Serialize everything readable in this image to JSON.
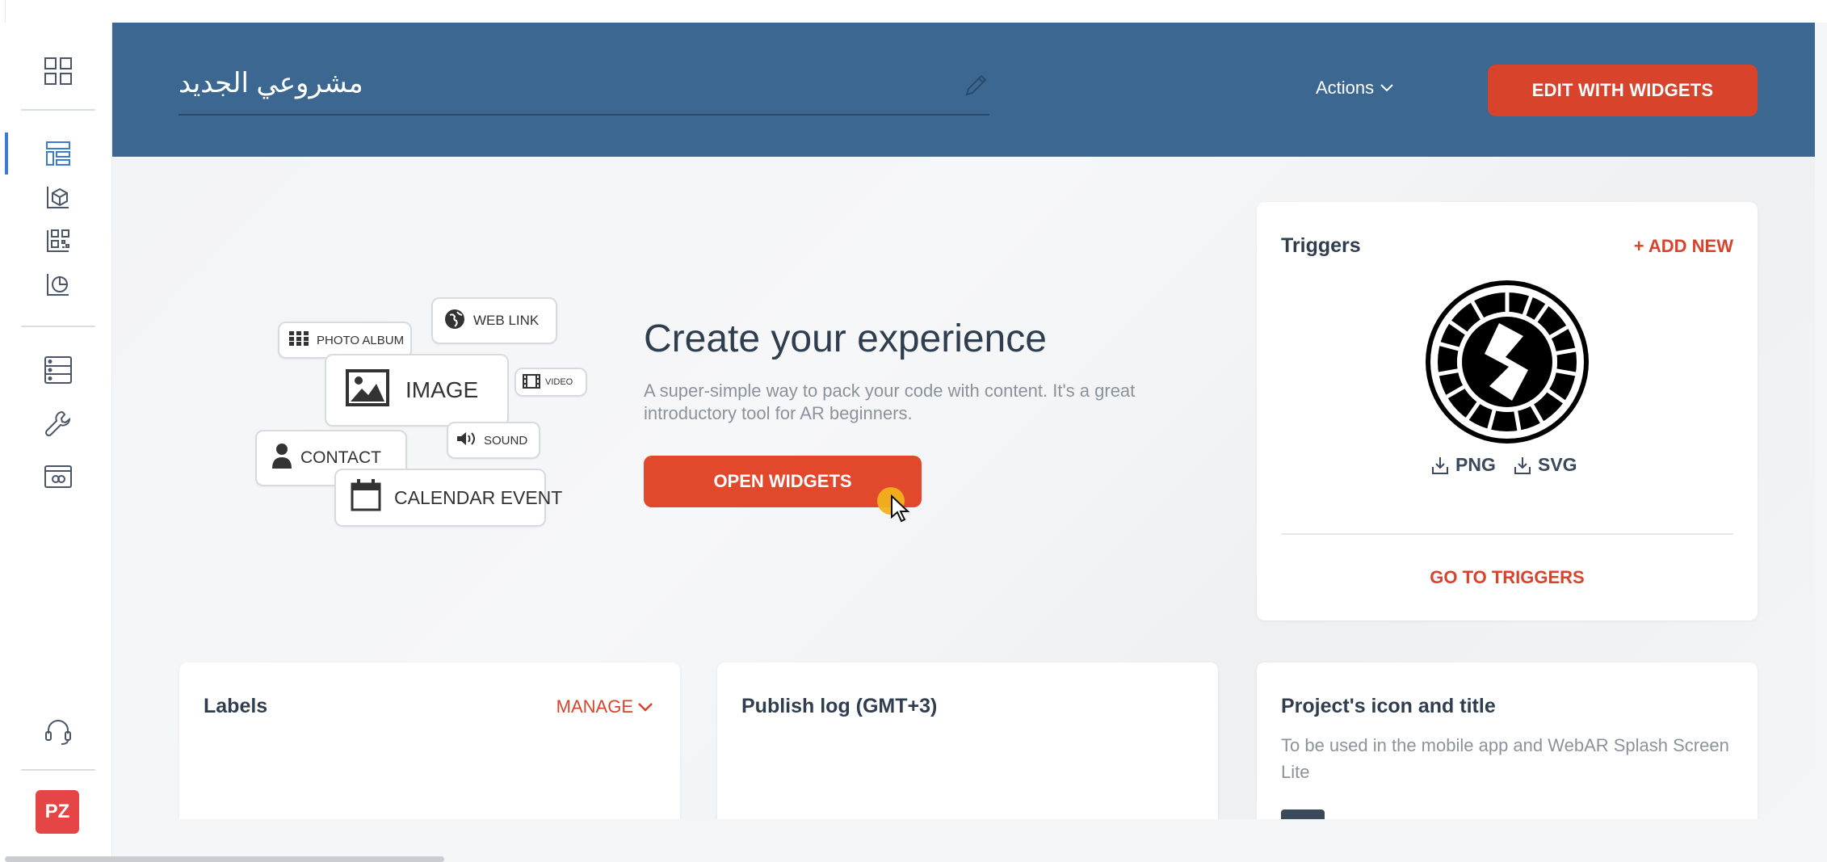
{
  "project": {
    "title": "مشروعي الجديد"
  },
  "header": {
    "actions_label": "Actions",
    "edit_button": "EDIT WITH WIDGETS"
  },
  "sidebar": {
    "avatar_initials": "PZ",
    "items": [
      {
        "icon": "grid-icon"
      },
      {
        "icon": "layout-icon",
        "active": true
      },
      {
        "icon": "cube-icon"
      },
      {
        "icon": "qr-code-icon"
      },
      {
        "icon": "analytics-icon"
      },
      {
        "icon": "list-icon"
      },
      {
        "icon": "wrench-icon"
      },
      {
        "icon": "webar-icon"
      },
      {
        "icon": "support-icon"
      }
    ]
  },
  "widgets_illustration": {
    "photo_album": "PHOTO ALBUM",
    "web_link": "WEB LINK",
    "image": "IMAGE",
    "video": "VIDEO",
    "contact": "CONTACT",
    "sound": "SOUND",
    "calendar_event": "CALENDAR EVENT"
  },
  "create": {
    "title": "Create your experience",
    "subtitle": "A super-simple way to pack your code with content. It's a great introductory tool for AR beginners.",
    "button": "OPEN WIDGETS"
  },
  "triggers": {
    "title": "Triggers",
    "add_new": "+ ADD NEW",
    "png_label": "PNG",
    "svg_label": "SVG",
    "go_to": "GO TO TRIGGERS"
  },
  "labels_card": {
    "title": "Labels",
    "manage": "MANAGE"
  },
  "publish_log": {
    "title": "Publish log (GMT+3)"
  },
  "project_icon": {
    "title": "Project's icon and title",
    "description": "To be used in the mobile app and WebAR Splash Screen Lite"
  },
  "colors": {
    "header_bg": "#3c6790",
    "accent_red": "#d8432c",
    "active_blue": "#3a7bd5"
  }
}
